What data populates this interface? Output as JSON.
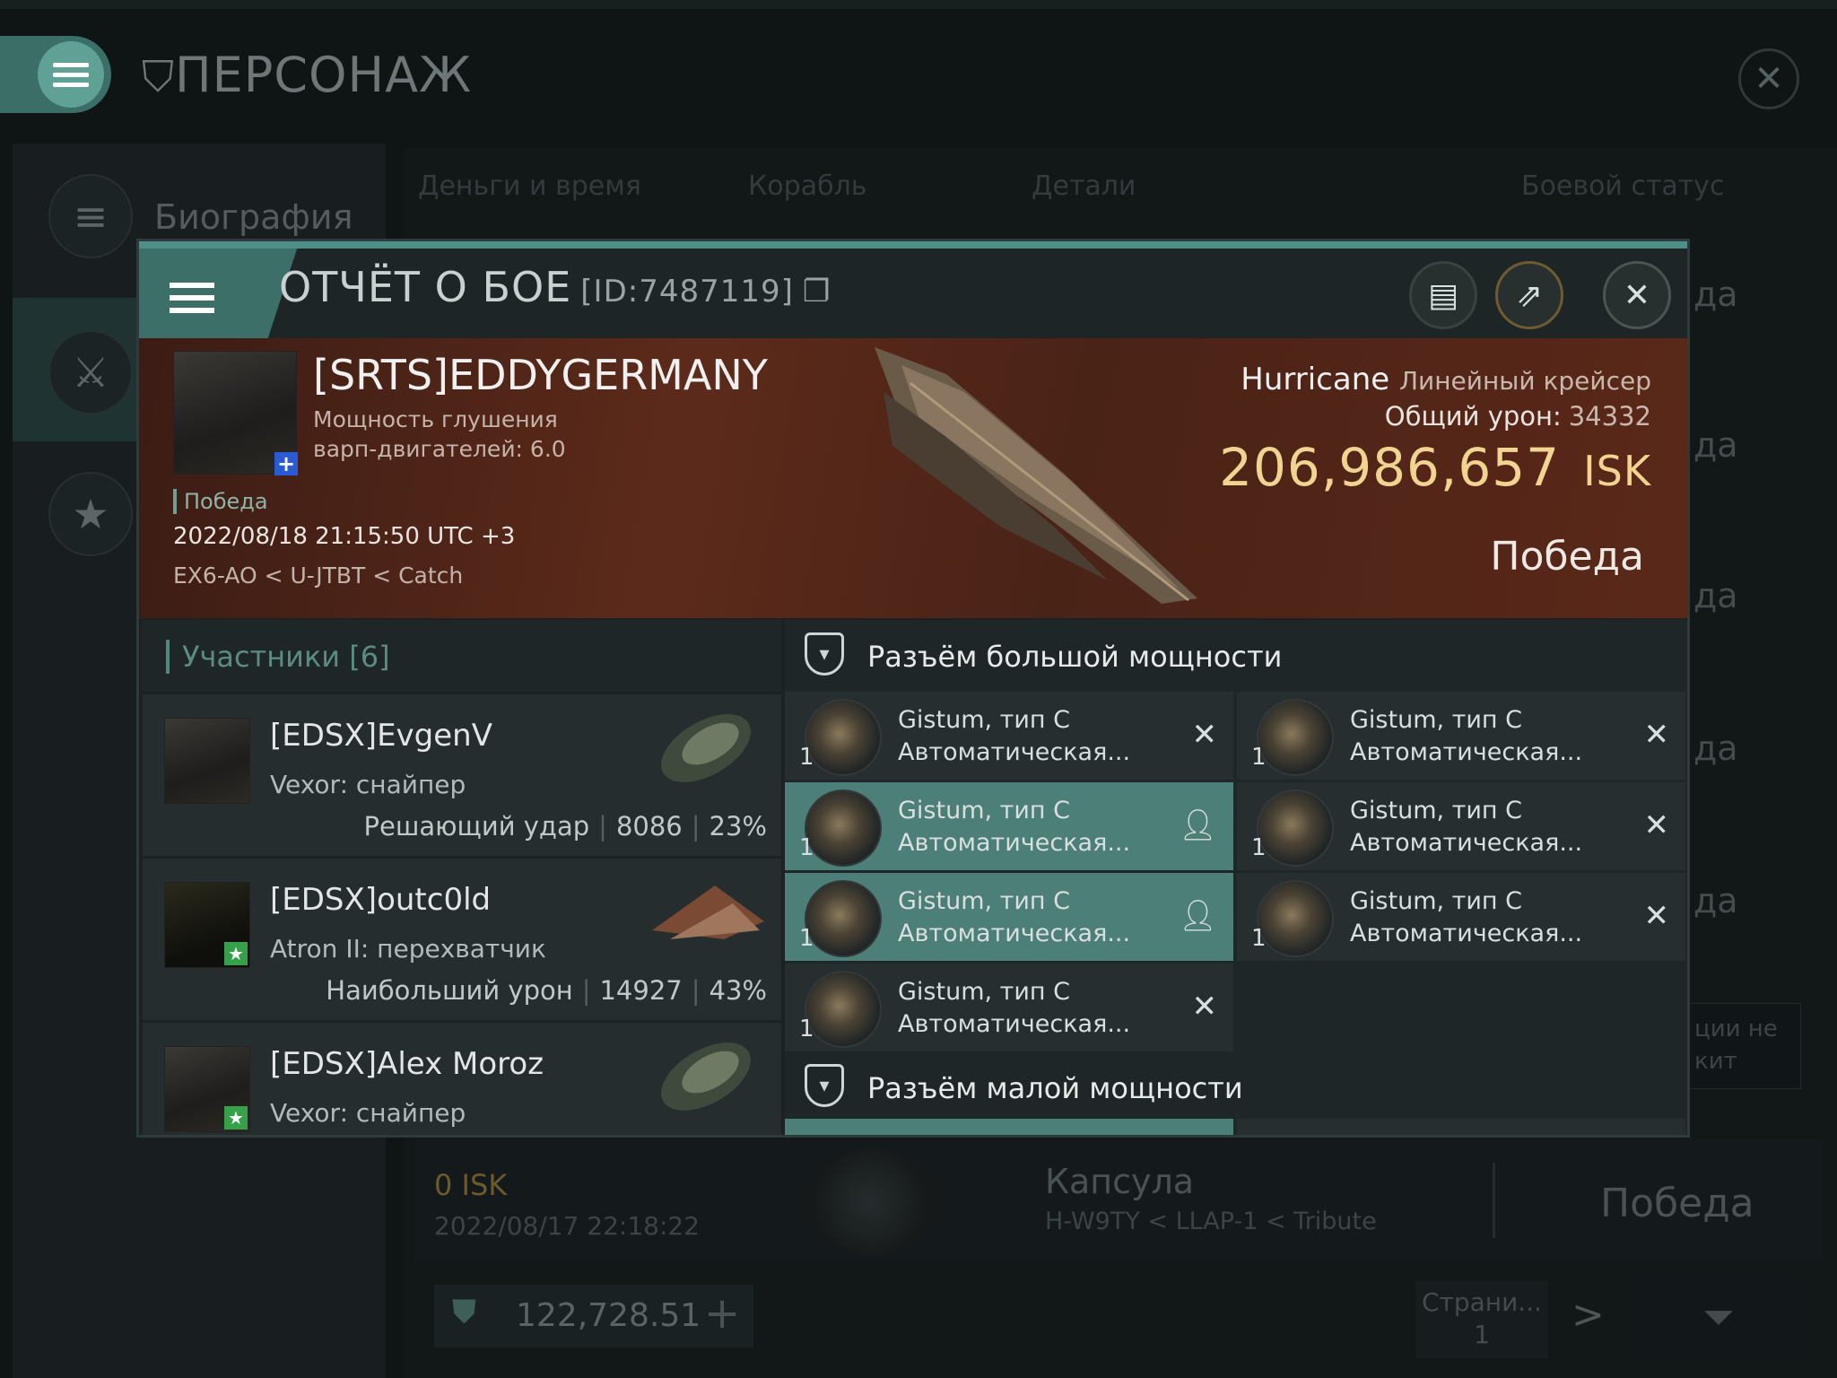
{
  "app": {
    "title": "ПЕРСОНАЖ",
    "sidebar": [
      {
        "label": "Биография",
        "icon": "menu-icon"
      },
      {
        "label": "",
        "icon": "crossed-swords-icon"
      },
      {
        "label": "",
        "icon": "star-badge-icon"
      }
    ],
    "tabs": [
      "Деньги и время",
      "Корабль",
      "Детали",
      "Боевой статус"
    ],
    "row_results": [
      "да",
      "да",
      "да",
      "да",
      "да"
    ],
    "side_hint": [
      "ции не",
      "кит"
    ],
    "bottom_row": {
      "isk": "0  ISK",
      "date": "2022/08/17  22:18:22",
      "ship": "Капсула",
      "location": "H-W9TY < LLAP-1 < Tribute",
      "result": "Победа"
    },
    "wallet": {
      "value": "122,728.51",
      "plus": "+"
    },
    "pagination": {
      "label": "Страни...",
      "page": "1",
      "next": ">"
    }
  },
  "report": {
    "title": "ОТЧЁТ О БОЕ",
    "id": "[ID:7487119]",
    "victim": {
      "name": "[SRTS]EDDYGERMANY",
      "subtitle": "Мощность глушения варп-двигателей: 6.0",
      "result_tag": "Победа",
      "datetime": "2022/08/18 21:15:50 UTC +3",
      "location": "EX6-AO < U-JTBT < Catch"
    },
    "ship": {
      "name": "Hurricane",
      "class": "Линейный крейсер",
      "damage_label": "Общий урон:",
      "damage_value": "34332",
      "isk_value": "206,986,657",
      "isk_unit": "ISK",
      "result": "Победа"
    },
    "participants": {
      "title": "Участники [6]",
      "items": [
        {
          "name": "[EDSX]EvgenV",
          "ship": "Vexor: снайпер",
          "role": "Решающий удар",
          "damage": "8086",
          "percent": "23%",
          "badge": ""
        },
        {
          "name": "[EDSX]outc0ld",
          "ship": "Atron II: перехватчик",
          "role": "Наибольший урон",
          "damage": "14927",
          "percent": "43%",
          "badge": "star"
        },
        {
          "name": "[EDSX]Alex Moroz",
          "ship": "Vexor: снайпер",
          "role": "",
          "damage": "",
          "percent": "",
          "badge": "star"
        }
      ]
    },
    "high_slots": {
      "title": "Разъём большой мощности",
      "modules": [
        {
          "qty": "1",
          "name": "Gistum, тип C",
          "type": "Автоматическая...",
          "state": "destroyed",
          "highlight": false
        },
        {
          "qty": "1",
          "name": "Gistum, тип C",
          "type": "Автоматическая...",
          "state": "destroyed",
          "highlight": false
        },
        {
          "qty": "1",
          "name": "Gistum, тип C",
          "type": "Автоматическая...",
          "state": "dropped",
          "highlight": true
        },
        {
          "qty": "1",
          "name": "Gistum, тип C",
          "type": "Автоматическая...",
          "state": "destroyed",
          "highlight": false
        },
        {
          "qty": "1",
          "name": "Gistum, тип C",
          "type": "Автоматическая...",
          "state": "dropped",
          "highlight": true
        },
        {
          "qty": "1",
          "name": "Gistum, тип C",
          "type": "Автоматическая...",
          "state": "destroyed",
          "highlight": false
        },
        {
          "qty": "1",
          "name": "Gistum, тип C",
          "type": "Автоматическая...",
          "state": "destroyed",
          "highlight": false
        }
      ]
    },
    "low_slots": {
      "title": "Разъём малой мощности"
    }
  }
}
